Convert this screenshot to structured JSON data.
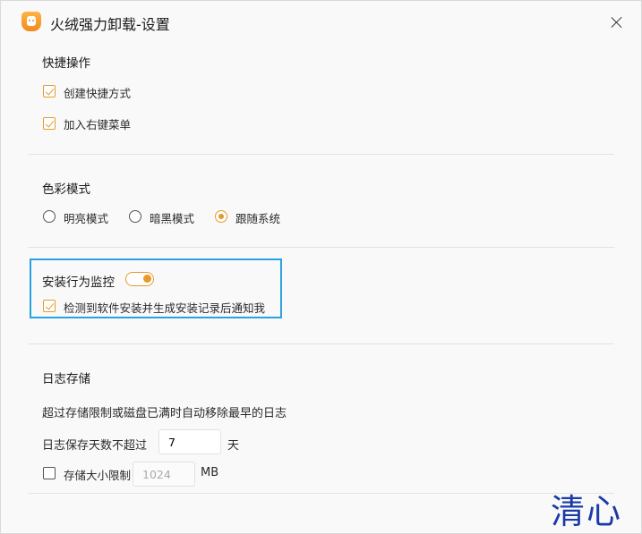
{
  "window": {
    "title": "火绒强力卸载-设置"
  },
  "shortcuts": {
    "title": "快捷操作",
    "create_shortcut": {
      "label": "创建快捷方式",
      "checked": true
    },
    "context_menu": {
      "label": "加入右键菜单",
      "checked": true
    }
  },
  "color_mode": {
    "title": "色彩模式",
    "options": [
      {
        "label": "明亮模式",
        "selected": false
      },
      {
        "label": "暗黑模式",
        "selected": false
      },
      {
        "label": "跟随系统",
        "selected": true
      }
    ]
  },
  "install_monitor": {
    "title": "安装行为监控",
    "enabled": true,
    "notify": {
      "label": "检测到软件安装并生成安装记录后通知我",
      "checked": true
    }
  },
  "log_storage": {
    "title": "日志存储",
    "description": "超过存储限制或磁盘已满时自动移除最早的日志",
    "days_label": "日志保存天数不超过",
    "days_value": "7",
    "days_unit": "天",
    "size_limit_label": "存储大小限制",
    "size_limit_checked": false,
    "size_value": "1024",
    "size_unit": "MB"
  },
  "watermark": "清心",
  "colors": {
    "accent": "#e79a2a",
    "highlight": "#2aa1e0"
  }
}
